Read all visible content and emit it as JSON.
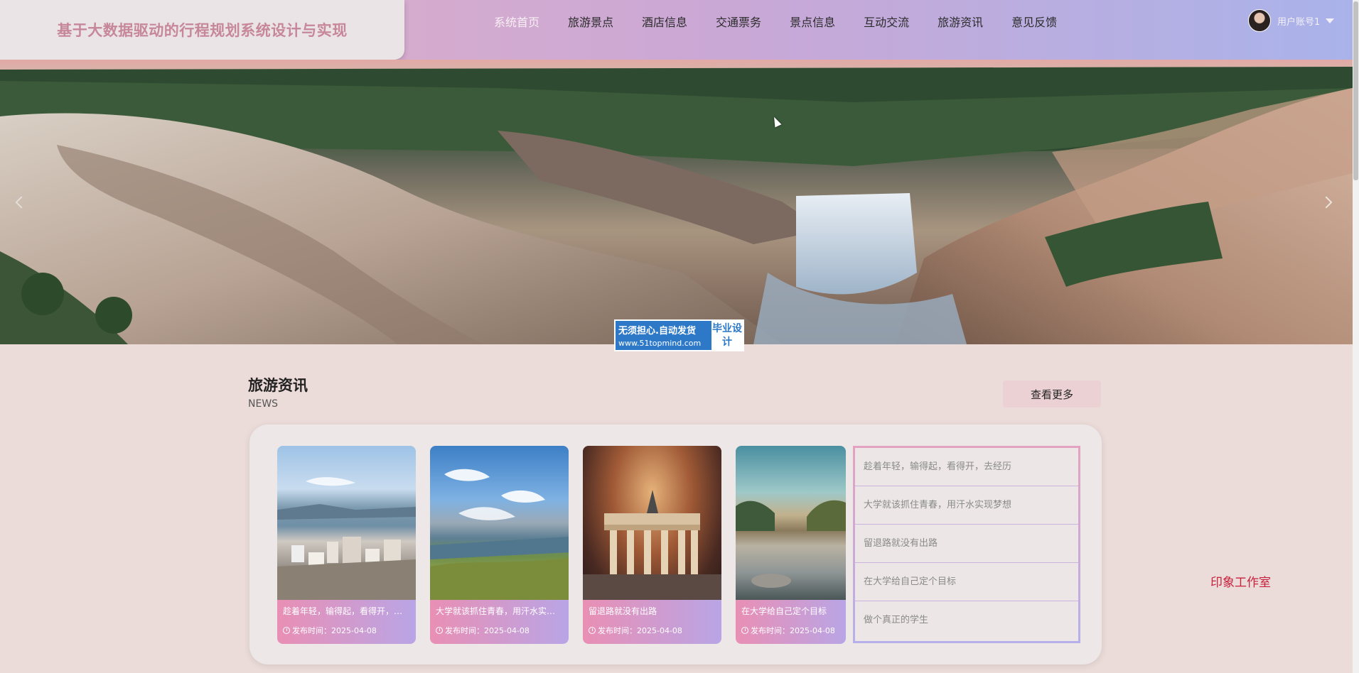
{
  "header": {
    "site_title": "基于大数据驱动的行程规划系统设计与实现",
    "nav": [
      {
        "label": "系统首页",
        "active": true
      },
      {
        "label": "旅游景点"
      },
      {
        "label": "酒店信息"
      },
      {
        "label": "交通票务"
      },
      {
        "label": "景点信息"
      },
      {
        "label": "互动交流"
      },
      {
        "label": "旅游资讯"
      },
      {
        "label": "意见反馈"
      }
    ],
    "user": {
      "name": "用户账号1",
      "avatar_icon": "user-avatar"
    }
  },
  "hero": {
    "image": "waterfall canyon banner",
    "watermark": {
      "line1": "无须担心.自动发货",
      "line2": "www.51topmind.com",
      "badge": "毕业设计"
    }
  },
  "news": {
    "title": "旅游资讯",
    "subtitle": "NEWS",
    "more_label": "查看更多",
    "cards": [
      {
        "title": "趁着年轻，输得起，看得开，去经历",
        "date": "发布时间：2025-04-08"
      },
      {
        "title": "大学就该抓住青春，用汗水实现梦想",
        "date": "发布时间：2025-04-08"
      },
      {
        "title": "留退路就没有出路",
        "date": "发布时间：2025-04-08"
      },
      {
        "title": "在大学给自己定个目标",
        "date": "发布时间：2025-04-08"
      }
    ],
    "list": [
      "趁着年轻，输得起，看得开，去经历",
      "大学就该抓住青春，用汗水实现梦想",
      "留退路就没有出路",
      "在大学给自己定个目标",
      "做个真正的学生"
    ]
  },
  "footer_note": "印象工作室",
  "colors": {
    "accent_pink": "#e98fb4",
    "accent_violet": "#b9a5e6",
    "title_pink": "#c6879b",
    "studio_red": "#c7213e"
  }
}
